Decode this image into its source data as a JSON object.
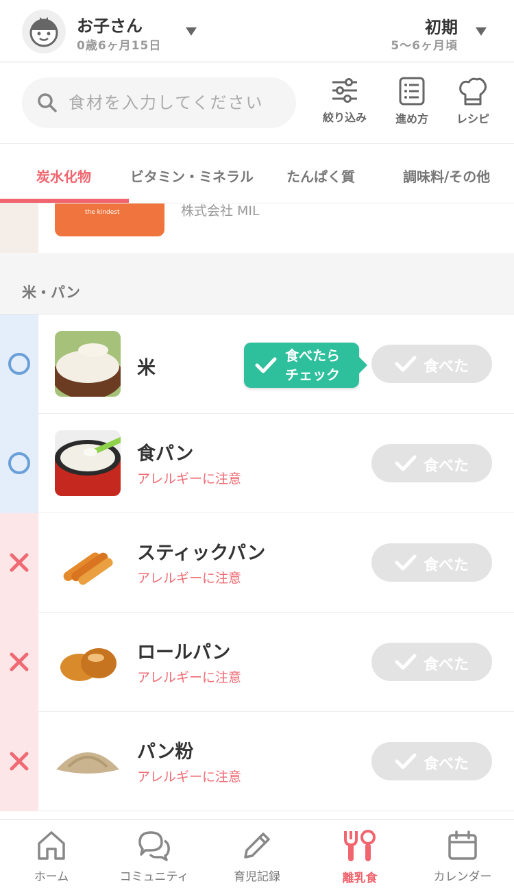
{
  "header": {
    "child_name": "お子さん",
    "child_age": "0歳6ヶ月15日",
    "stage_name": "初期",
    "stage_range": "5〜6ヶ月頃"
  },
  "search": {
    "placeholder": "食材を入力してください"
  },
  "toolbar": {
    "filter_label": "絞り込み",
    "guide_label": "進め方",
    "recipe_label": "レシピ"
  },
  "tabs": [
    {
      "label": "炭水化物",
      "active": true
    },
    {
      "label": "ビタミン・ミネラル"
    },
    {
      "label": "たんぱく質"
    },
    {
      "label": "調味料/その他"
    }
  ],
  "promo": {
    "thumb_text": "the kindest",
    "maker": "株式会社 MIL"
  },
  "section": {
    "title": "米・パン"
  },
  "tooltip": {
    "line1": "食べたら",
    "line2": "チェック"
  },
  "ate_label": "食べた",
  "foods": [
    {
      "name": "米",
      "warning": "",
      "status": "ok"
    },
    {
      "name": "食パン",
      "warning": "アレルギーに注意",
      "status": "ok"
    },
    {
      "name": "スティックパン",
      "warning": "アレルギーに注意",
      "status": "ng"
    },
    {
      "name": "ロールパン",
      "warning": "アレルギーに注意",
      "status": "ng"
    },
    {
      "name": "パン粉",
      "warning": "アレルギーに注意",
      "status": "ng"
    }
  ],
  "nav": [
    {
      "label": "ホーム",
      "icon": "home-icon"
    },
    {
      "label": "コミュニティ",
      "icon": "chat-icon"
    },
    {
      "label": "育児記録",
      "icon": "pencil-icon"
    },
    {
      "label": "離乳食",
      "icon": "cutlery-icon",
      "active": true
    },
    {
      "label": "カレンダー",
      "icon": "calendar-icon"
    }
  ],
  "colors": {
    "accent": "#f0656e",
    "ok": "#6a9fd8",
    "ng": "#ef6a72",
    "tooltip": "#2ebf9c"
  }
}
